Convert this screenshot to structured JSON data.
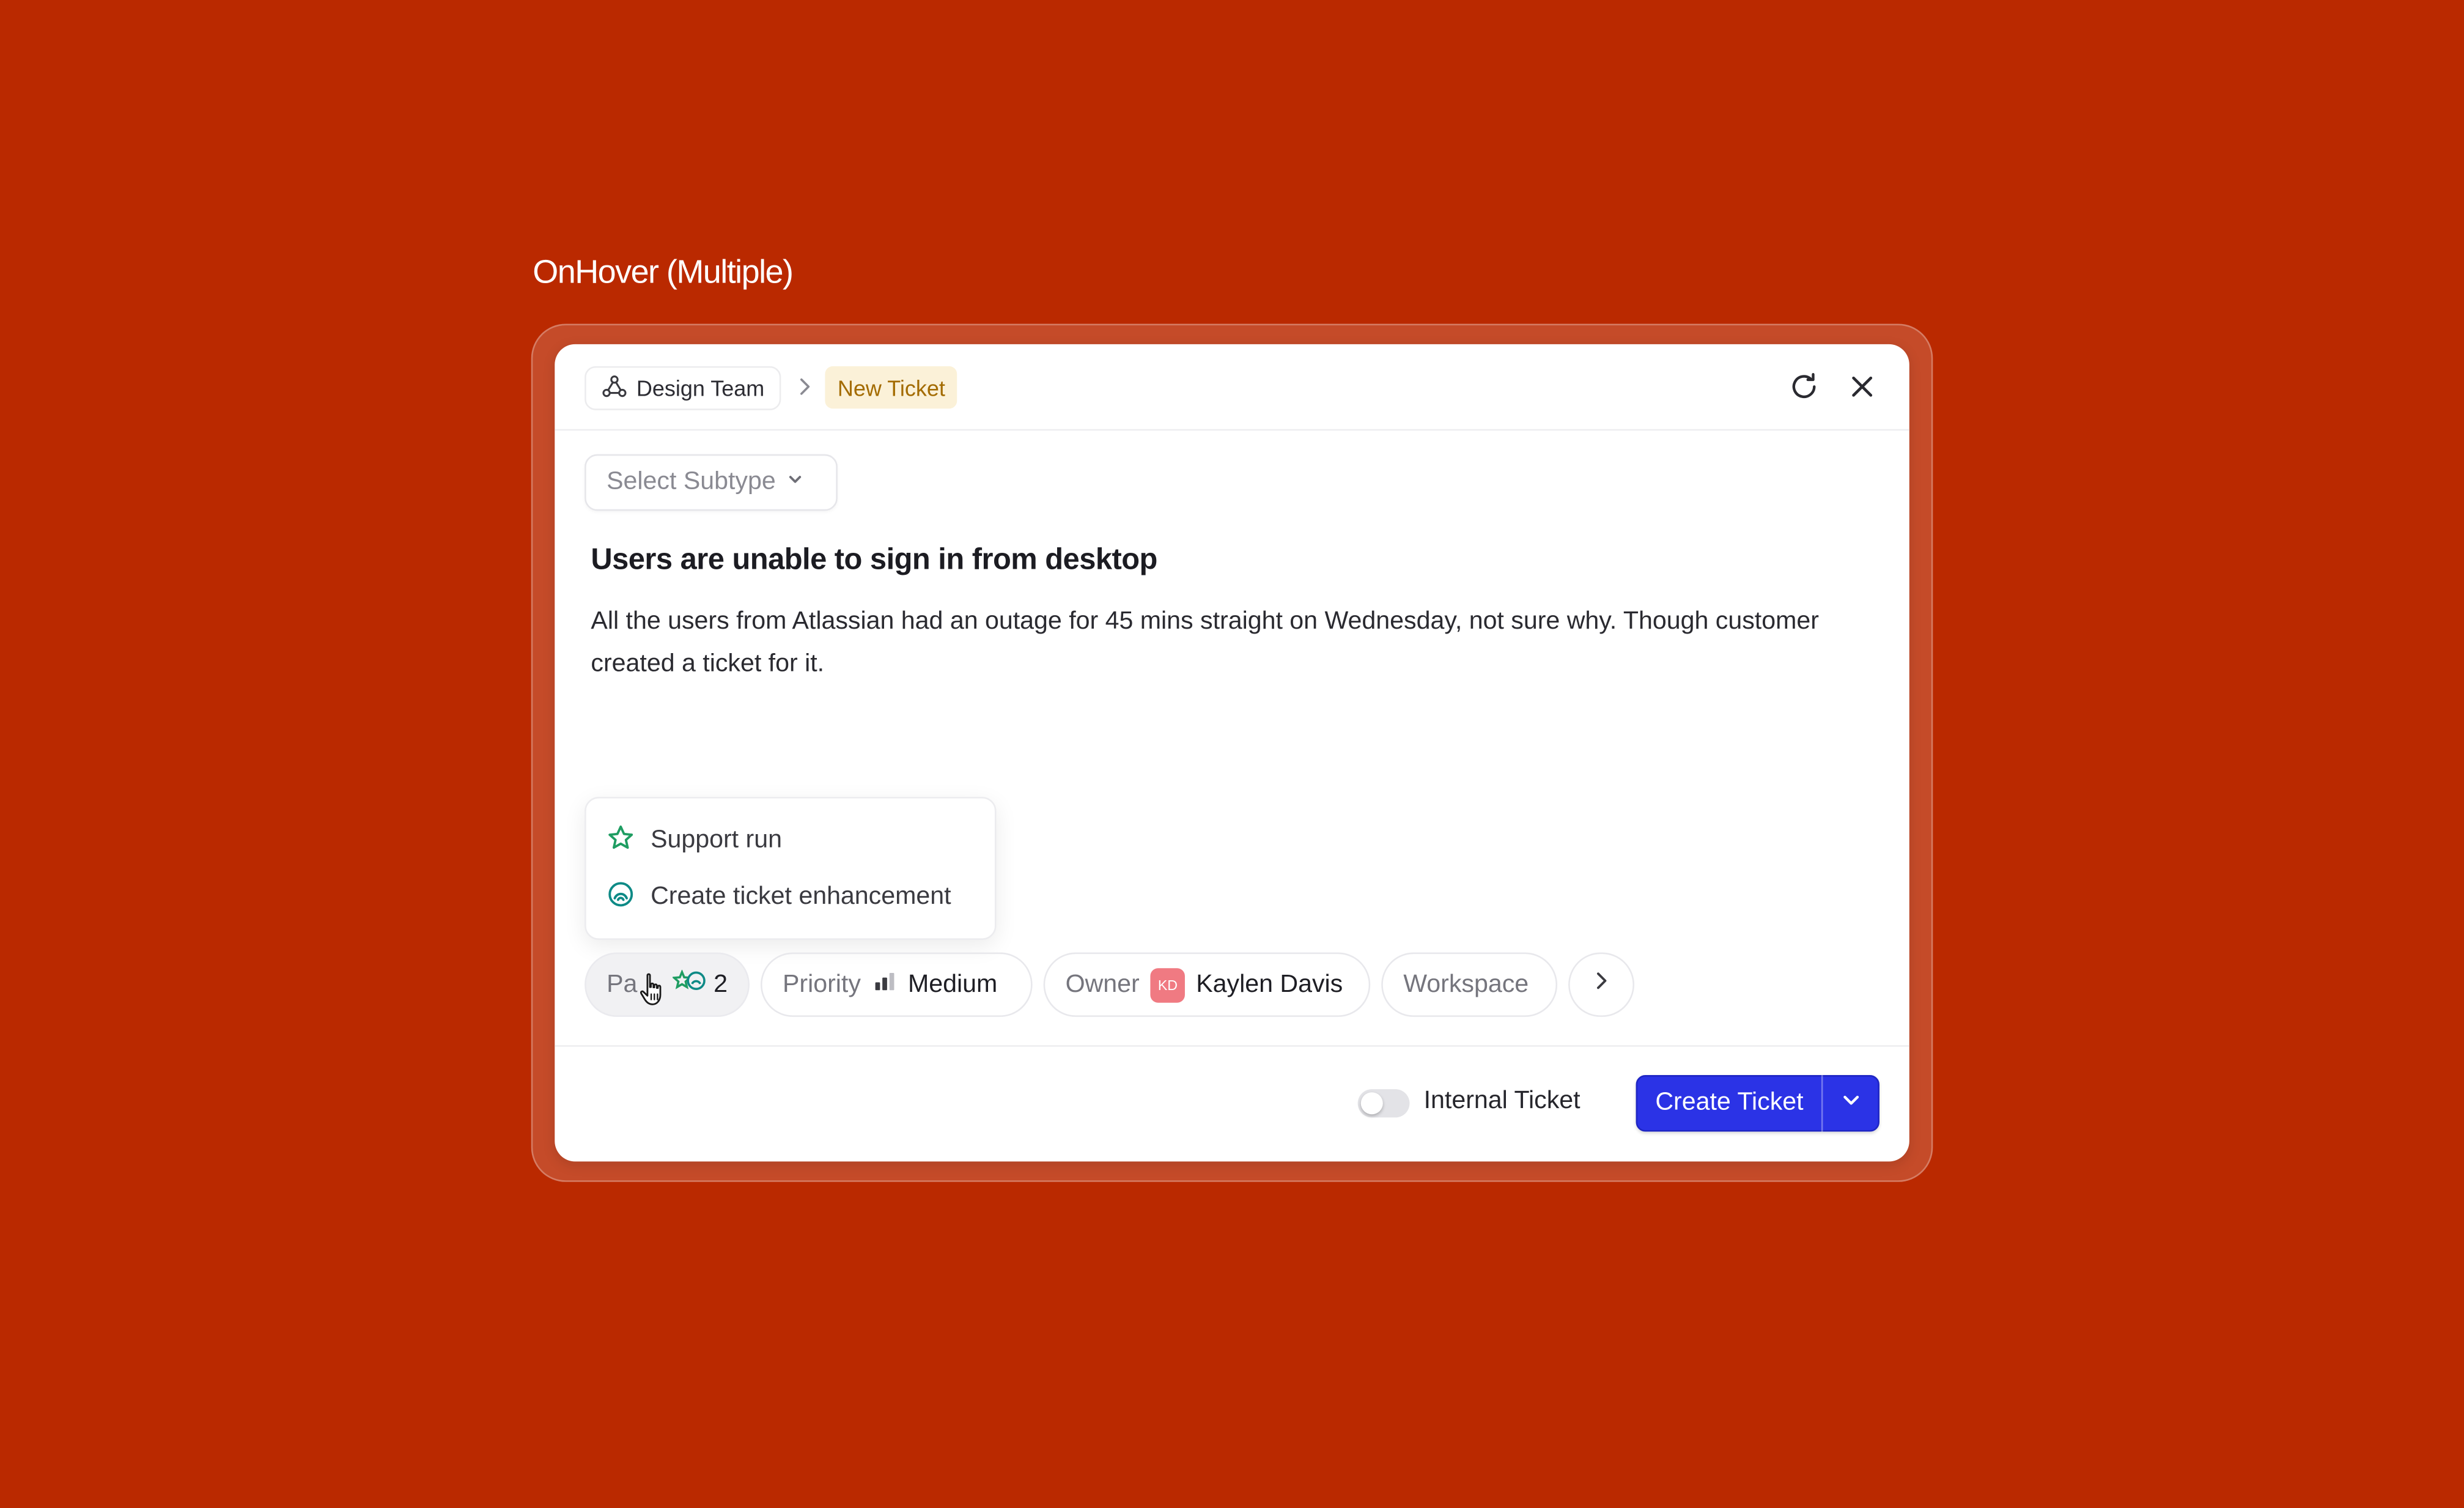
{
  "frame": {
    "title": "OnHover (Multiple)"
  },
  "header": {
    "team_label": "Design Team",
    "new_ticket_label": "New Ticket"
  },
  "subtype": {
    "placeholder": "Select Subtype"
  },
  "ticket": {
    "title": "Users are unable to sign in from desktop",
    "description": "All the users from Atlassian had an outage for 45 mins straight on Wednesday, not sure why. Though customer created a ticket for it."
  },
  "popover": {
    "items": [
      {
        "label": "Support run",
        "icon": "star-icon"
      },
      {
        "label": "Create ticket enhancement",
        "icon": "enhancement-icon"
      }
    ]
  },
  "chips": {
    "parts": {
      "label": "Pa",
      "count": "2"
    },
    "priority": {
      "label": "Priority",
      "value": "Medium"
    },
    "owner": {
      "label": "Owner",
      "initials": "KD",
      "value": "Kaylen Davis"
    },
    "workspace": {
      "label": "Workspace"
    }
  },
  "footer": {
    "internal_label": "Internal Ticket",
    "internal_enabled": false,
    "create_label": "Create Ticket"
  },
  "colors": {
    "background": "#BA2900",
    "primary": "#2B33E6",
    "badge_bg": "#FBF1D8",
    "badge_text": "#A36B00",
    "avatar": "#F07A82",
    "icon_green": "#1F9D62",
    "icon_teal": "#0E8A86"
  }
}
